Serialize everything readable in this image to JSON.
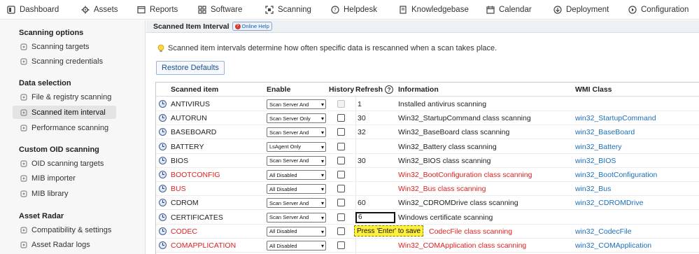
{
  "nav": {
    "items": [
      {
        "label": "Dashboard",
        "icon": "dashboard-icon"
      },
      {
        "label": "Assets",
        "icon": "gear-icon"
      },
      {
        "label": "Reports",
        "icon": "reports-icon"
      },
      {
        "label": "Software",
        "icon": "software-icon"
      },
      {
        "label": "Scanning",
        "icon": "scan-icon"
      },
      {
        "label": "Helpdesk",
        "icon": "help-icon"
      },
      {
        "label": "Knowledgebase",
        "icon": "book-icon"
      },
      {
        "label": "Calendar",
        "icon": "calendar-icon"
      },
      {
        "label": "Deployment",
        "icon": "deployment-icon"
      },
      {
        "label": "Configuration",
        "icon": "configuration-icon"
      }
    ]
  },
  "sidebar": {
    "sections": [
      {
        "title": "Scanning options",
        "items": [
          {
            "label": "Scanning targets",
            "icon": "wrench-icon"
          },
          {
            "label": "Scanning credentials",
            "icon": "key-icon"
          }
        ]
      },
      {
        "title": "Data selection",
        "items": [
          {
            "label": "File & registry scanning",
            "icon": "file-icon"
          },
          {
            "label": "Scanned item interval",
            "icon": "list-icon",
            "active": true
          },
          {
            "label": "Performance scanning",
            "icon": "gauge-icon"
          }
        ]
      },
      {
        "title": "Custom OID scanning",
        "items": [
          {
            "label": "OID scanning targets",
            "icon": "target-icon"
          },
          {
            "label": "MIB importer",
            "icon": "import-icon"
          },
          {
            "label": "MIB library",
            "icon": "library-icon"
          }
        ]
      },
      {
        "title": "Asset Radar",
        "items": [
          {
            "label": "Compatibility & settings",
            "icon": "search-icon"
          },
          {
            "label": "Asset Radar logs",
            "icon": "log-icon"
          }
        ]
      }
    ]
  },
  "panel": {
    "title": "Scanned Item Interval",
    "help_label": "Online Help",
    "info_text": "Scanned item intervals determine how often specific data is rescanned when a scan takes place.",
    "restore_label": "Restore Defaults"
  },
  "table": {
    "headers": {
      "item": "Scanned item",
      "enable": "Enable",
      "history": "History",
      "refresh": "Refresh",
      "info": "Information",
      "wmi": "WMI Class"
    },
    "rows": [
      {
        "name": "ANTIVIRUS",
        "enable": "Scan Server And",
        "history_disabled": true,
        "refresh": "1",
        "info": "Installed antivirus scanning",
        "wmi": "",
        "red": false
      },
      {
        "name": "AUTORUN",
        "enable": "Scan Server Only",
        "history_disabled": false,
        "refresh": "30",
        "info": "Win32_StartupCommand class scanning",
        "wmi": "win32_StartupCommand",
        "red": false
      },
      {
        "name": "BASEBOARD",
        "enable": "Scan Server And",
        "history_disabled": false,
        "refresh": "32",
        "info": "Win32_BaseBoard class scanning",
        "wmi": "win32_BaseBoard",
        "red": false
      },
      {
        "name": "BATTERY",
        "enable": "LsAgent Only",
        "history_disabled": false,
        "refresh": "",
        "info": "Win32_Battery class scanning",
        "wmi": "win32_Battery",
        "red": false
      },
      {
        "name": "BIOS",
        "enable": "Scan Server And",
        "history_disabled": false,
        "refresh": "30",
        "info": "Win32_BIOS class scanning",
        "wmi": "win32_BIOS",
        "red": false
      },
      {
        "name": "BOOTCONFIG",
        "enable": "All Disabled",
        "history_disabled": false,
        "refresh": "",
        "info": "Win32_BootConfiguration class scanning",
        "wmi": "win32_BootConfiguration",
        "red": true
      },
      {
        "name": "BUS",
        "enable": "All Disabled",
        "history_disabled": false,
        "refresh": "",
        "info": "Win32_Bus class scanning",
        "wmi": "win32_Bus",
        "red": true
      },
      {
        "name": "CDROM",
        "enable": "Scan Server And",
        "history_disabled": false,
        "refresh": "60",
        "info": "Win32_CDROMDrive class scanning",
        "wmi": "win32_CDROMDrive",
        "red": false
      },
      {
        "name": "CERTIFICATES",
        "enable": "Scan Server And",
        "history_disabled": false,
        "refresh": "6",
        "info": "Windows certificate scanning",
        "wmi": "",
        "red": false,
        "editing": true
      },
      {
        "name": "CODEC",
        "enable": "All Disabled",
        "history_disabled": false,
        "refresh": "",
        "info": "CodecFile class scanning",
        "wmi": "win32_CodecFile",
        "red": true
      },
      {
        "name": "COMAPPLICATION",
        "enable": "All Disabled",
        "history_disabled": false,
        "refresh": "",
        "info": "Win32_COMApplication class scanning",
        "wmi": "win32_COMApplication",
        "red": true
      }
    ]
  },
  "tooltip": {
    "text": "Press 'Enter' to save"
  },
  "colors": {
    "red": "#e02121",
    "link": "#1b6fb8",
    "tooltip_bg": "#fff03c"
  }
}
